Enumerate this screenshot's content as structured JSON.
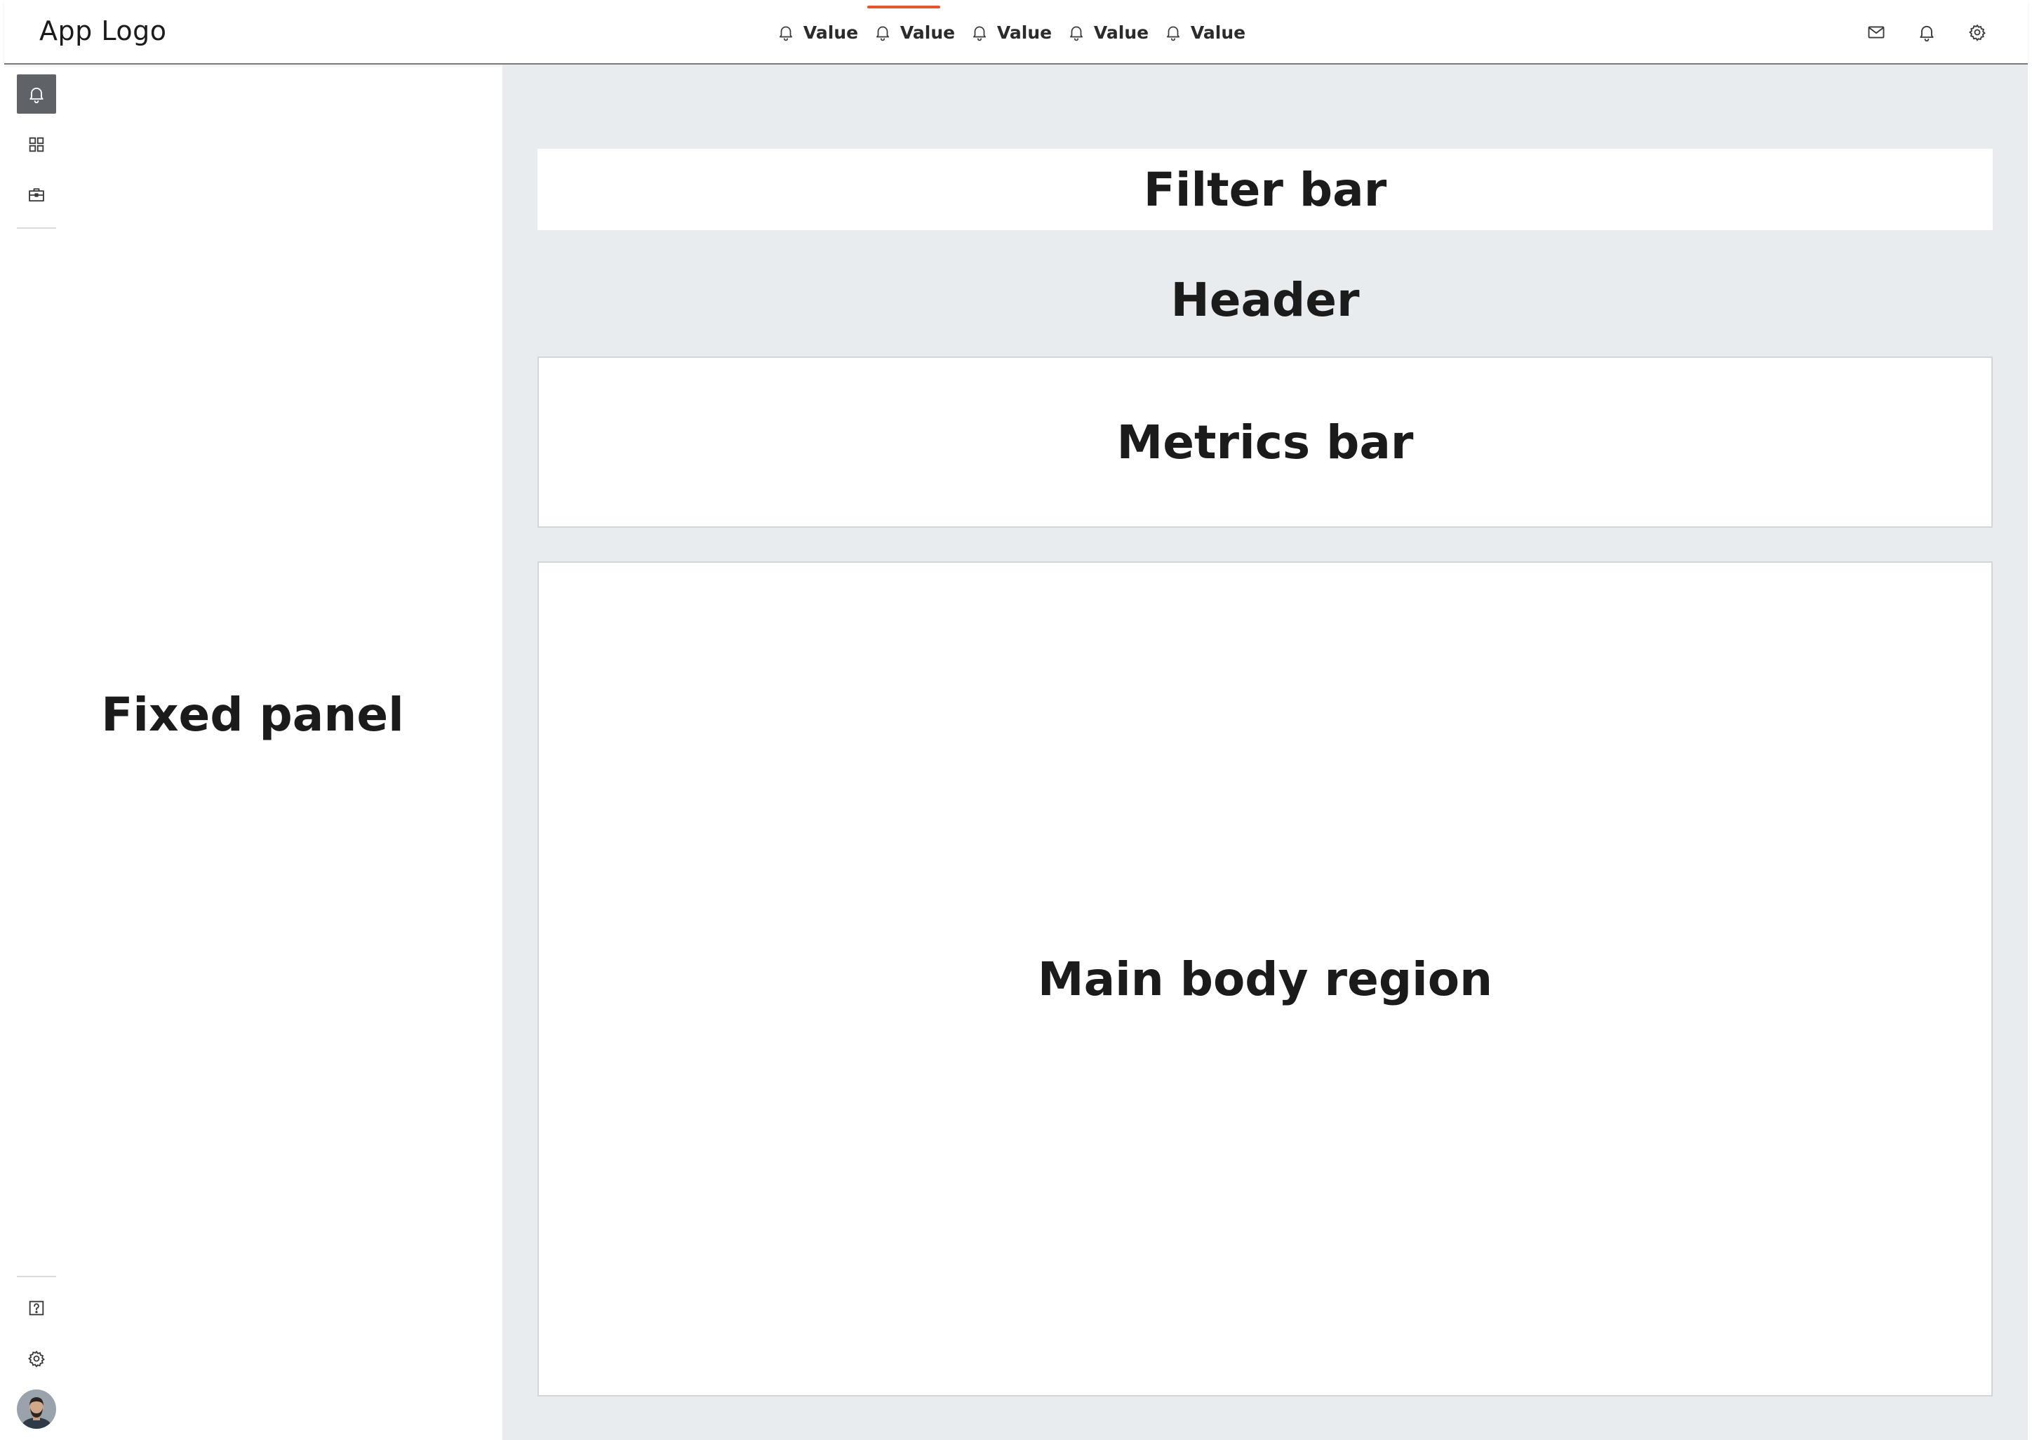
{
  "app": {
    "logo_text": "App Logo"
  },
  "topnav": {
    "tabs": [
      {
        "label": "Value",
        "icon": "bell-icon",
        "active": false
      },
      {
        "label": "Value",
        "icon": "bell-icon",
        "active": true
      },
      {
        "label": "Value",
        "icon": "bell-icon",
        "active": false
      },
      {
        "label": "Value",
        "icon": "bell-icon",
        "active": false
      },
      {
        "label": "Value",
        "icon": "bell-icon",
        "active": false
      }
    ],
    "actions": [
      {
        "icon": "mail-icon"
      },
      {
        "icon": "bell-icon"
      },
      {
        "icon": "gear-icon"
      }
    ],
    "active_accent": "#e4572e"
  },
  "rail": {
    "top_items": [
      {
        "icon": "bell-icon",
        "selected": true
      },
      {
        "icon": "grid-icon",
        "selected": false
      },
      {
        "icon": "briefcase-icon",
        "selected": false
      }
    ],
    "bottom_items": [
      {
        "icon": "help-icon"
      },
      {
        "icon": "gear-icon"
      },
      {
        "icon": "user-avatar"
      }
    ]
  },
  "regions": {
    "fixed_panel": "Fixed panel",
    "filter_bar": "Filter bar",
    "header": "Header",
    "metrics_bar": "Metrics bar",
    "main_body": "Main body region"
  },
  "colors": {
    "main_background": "#e8ecef",
    "rail_selected": "#5f6368"
  }
}
